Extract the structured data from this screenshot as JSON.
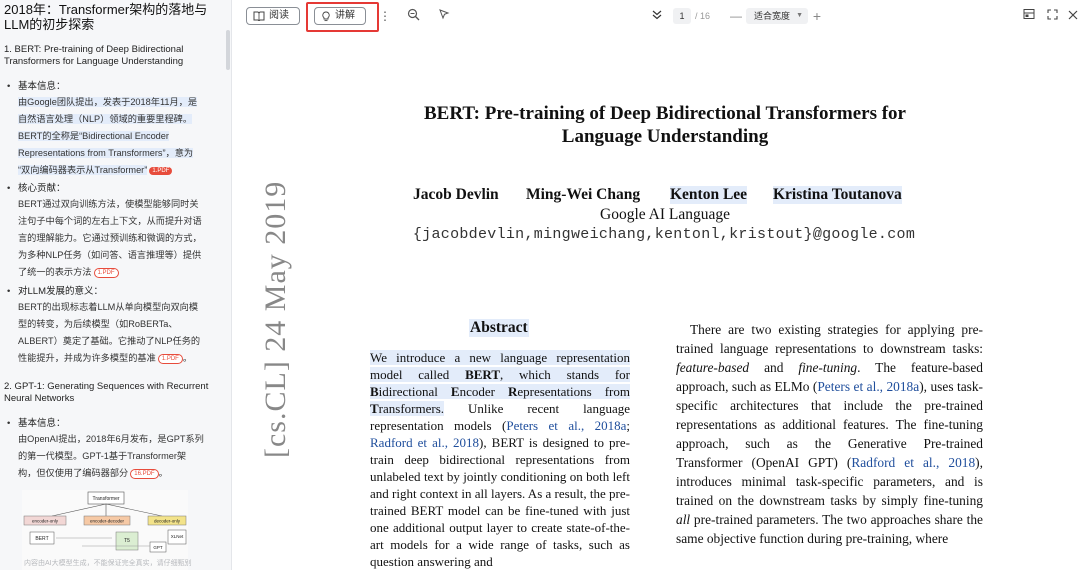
{
  "sidebar": {
    "title": "2018年：Transformer架构的落地与LLM的初步探索",
    "sections": [
      {
        "heading": "1. BERT: Pre-training of Deep Bidirectional Transformers for Language Understanding",
        "items": [
          {
            "label": "基本信息：",
            "lines": [
              "由Google团队提出，发表于2018年11月，是",
              "自然语言处理（NLP）领域的重要里程碑。",
              "BERT的全称是“Bidirectional Encoder",
              "Representations from Transformers”，意为",
              "“双向编码器表示从Transformer”"
            ],
            "ref": "1.PDF"
          },
          {
            "label": "核心贡献：",
            "lines": [
              "BERT通过双向训练方法，使模型能够同时关",
              "注句子中每个词的左右上下文，从而提升对语",
              "言的理解能力。它通过预训练和微调的方式，",
              "为多种NLP任务（如问答、语言推理等）提供",
              "了统一的表示方法"
            ],
            "ref": "1.PDF"
          },
          {
            "label": "对LLM发展的意义：",
            "lines": [
              "BERT的出现标志着LLM从单向模型向双向模",
              "型的转变，为后续模型（如RoBERTa、",
              "ALBERT）奠定了基础。它推动了NLP任务的",
              "性能提升，并成为许多模型的基准"
            ],
            "ref": "1.PDF",
            "tail": "。"
          }
        ]
      },
      {
        "heading": "2. GPT-1: Generating Sequences with Recurrent Neural Networks",
        "items": [
          {
            "label": "基本信息：",
            "lines": [
              "由OpenAI提出，2018年6月发布，是GPT系列",
              "的第一代模型。GPT-1基于Transformer架",
              "构，但仅使用了编码器部分"
            ],
            "ref": "16.PDF",
            "tail": "。"
          }
        ]
      }
    ],
    "diagram_labels": [
      "Transformer",
      "encoder-only",
      "encoder-decoder",
      "decoder-only",
      "BERT",
      "T5",
      "GPT",
      "XLNet"
    ],
    "footer": "内容由AI大模型生成，不能保证完全真实，请仔细甄别"
  },
  "toolbar": {
    "read_label": "阅读",
    "explain_label": "讲解",
    "page_current": "1",
    "page_total": "/ 16",
    "zoom_label": "适合宽度"
  },
  "paper": {
    "title_line1": "BERT: Pre-training of Deep Bidirectional Transformers for",
    "title_line2": "Language Understanding",
    "authors": [
      "Jacob Devlin",
      "Ming-Wei Chang",
      "Kenton Lee",
      "Kristina Toutanova"
    ],
    "affiliation": "Google AI Language",
    "emails": "{jacobdevlin,mingweichang,kentonl,kristout}@google.com",
    "arxiv_stamp": "[cs.CL]  24 May 2019",
    "abstract_heading": "Abstract"
  },
  "colors": {
    "highlight": "#e3ecfa",
    "citation": "#1f4e9c",
    "pdf_badge": "#e74c3c",
    "frame": "#e53935"
  }
}
